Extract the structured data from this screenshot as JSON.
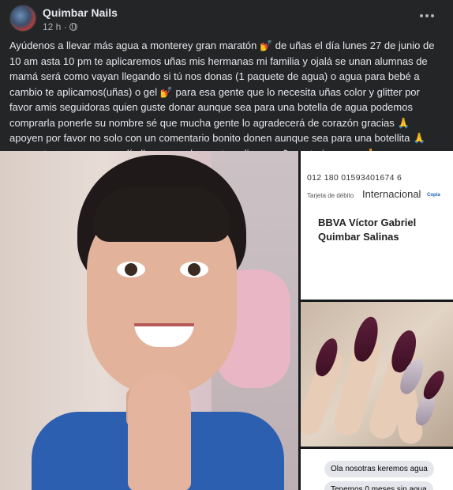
{
  "post": {
    "author": "Quimbar Nails",
    "time": "12 h ·",
    "privacy_icon": "globe-icon",
    "more_icon": "more-horizontal-icon",
    "text": "Ayúdenos a llevar más agua a monterey gran maratón 💅 de uñas el día lunes 27 de junio de 10 am asta 10 pm te aplicaremos uñas mis hermanas mi familia y  ojalá se unan alumnas de mamá será como vayan llegando si tú nos donas (1 paquete de agua) o agua para bebé a cambio te aplicamos(uñas) o gel 💅 para esa gente que lo necesita uñas color y glitter por favor amis seguidoras quien guste donar aunque sea para una botella de agua podemos comprarla ponerle su nombre sé que mucha gente lo agradecerá de corazón gracias 🙏 apoyen por favor no solo con un comentario bonito donen aunque sea para una botellita 🙏 compartan para que ese día llegue mucha gente aplicarse uñas y traiga agua 🙏"
  },
  "photos": {
    "account": {
      "number": "012 180 01593401674 6",
      "card_type": "Tarjeta de débito",
      "brand": "Internacional",
      "brand_small": "Copia",
      "holder_line1": "BBVA Víctor Gabriel",
      "holder_line2": "Quimbar Salinas"
    },
    "chat": {
      "message1": "Ola nosotras keremos agua",
      "message2": "Tenemos 0 meses sin agua"
    }
  }
}
